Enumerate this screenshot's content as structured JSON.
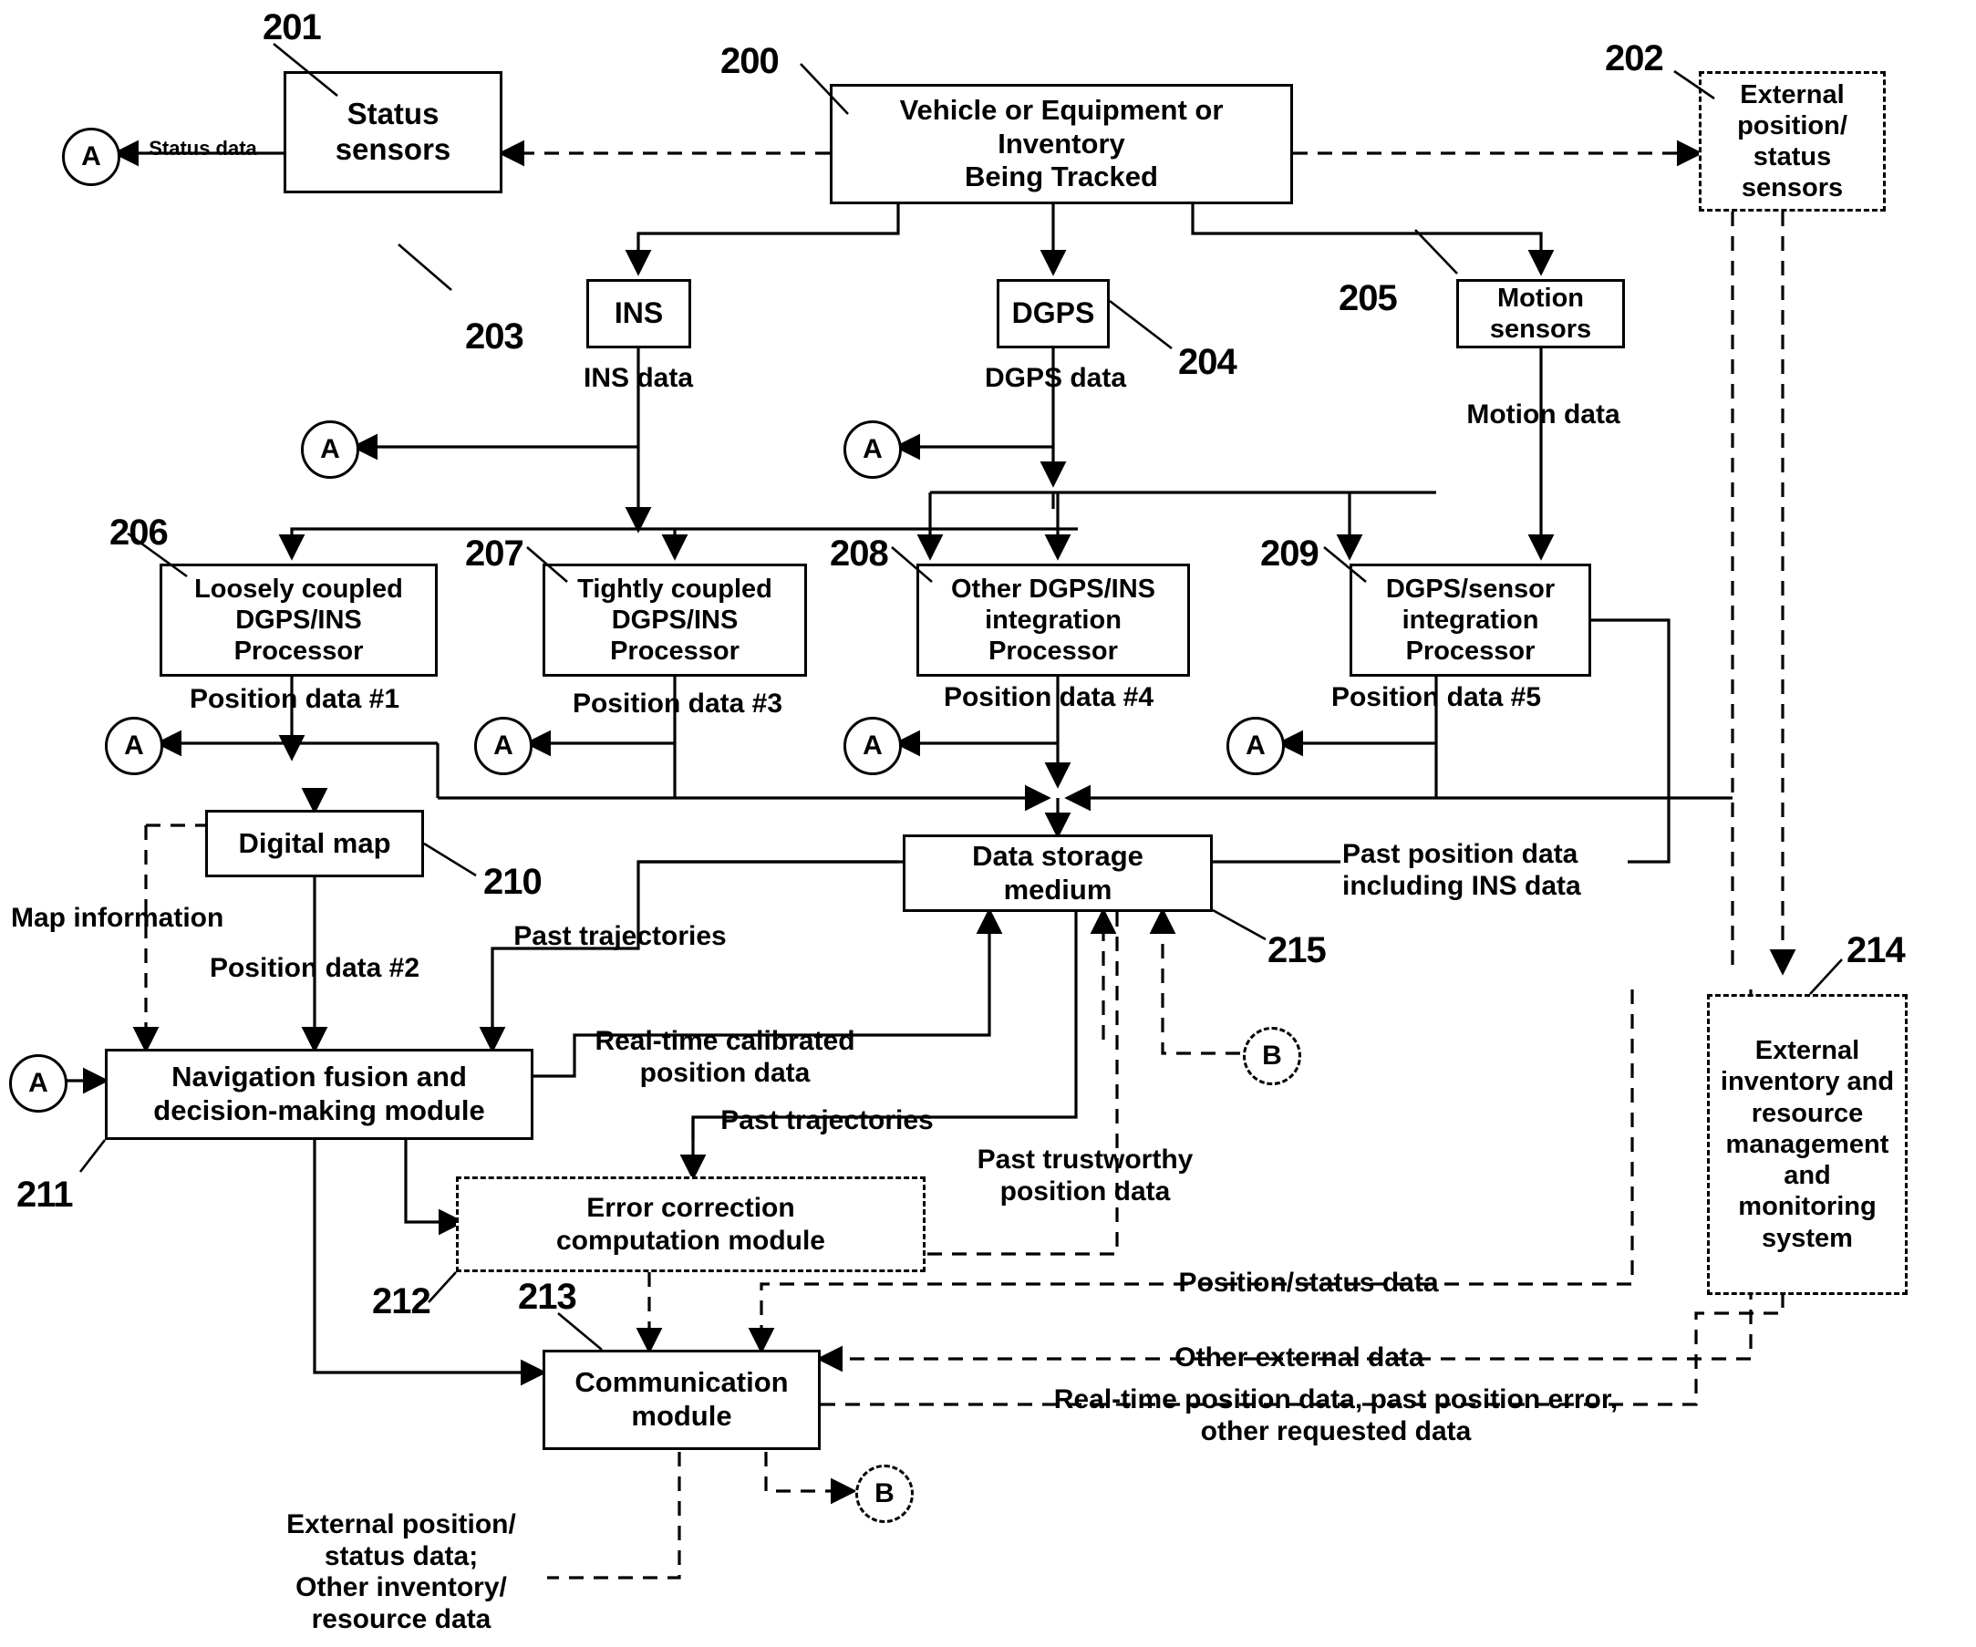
{
  "diagram": {
    "title": "Tracking system block diagram",
    "boxes": [
      {
        "id": "status_sensors",
        "ref": "201",
        "label": "Status\nsensors",
        "style": "solid"
      },
      {
        "id": "vehicle",
        "ref": "200",
        "label": "Vehicle or Equipment or\nInventory\nBeing Tracked",
        "style": "solid"
      },
      {
        "id": "external_sensors",
        "ref": "202",
        "label": "External\nposition/\nstatus\nsensors",
        "style": "dashed"
      },
      {
        "id": "ins",
        "ref": "203",
        "label": "INS",
        "style": "solid"
      },
      {
        "id": "dgps",
        "ref": "204",
        "label": "DGPS",
        "style": "solid"
      },
      {
        "id": "motion_sensors",
        "ref": "205",
        "label": "Motion\nsensors",
        "style": "solid"
      },
      {
        "id": "loosely_coupled",
        "ref": "206",
        "label": "Loosely coupled\nDGPS/INS\nProcessor",
        "style": "solid"
      },
      {
        "id": "tightly_coupled",
        "ref": "207",
        "label": "Tightly coupled\nDGPS/INS\nProcessor",
        "style": "solid"
      },
      {
        "id": "other_integration",
        "ref": "208",
        "label": "Other DGPS/INS\nintegration\nProcessor",
        "style": "solid"
      },
      {
        "id": "dgps_sensor_integration",
        "ref": "209",
        "label": "DGPS/sensor\nintegration\nProcessor",
        "style": "solid"
      },
      {
        "id": "digital_map",
        "ref": "210",
        "label": "Digital map",
        "style": "solid"
      },
      {
        "id": "navigation_fusion",
        "ref": "211",
        "label": "Navigation fusion and\ndecision-making module",
        "style": "solid"
      },
      {
        "id": "error_correction",
        "ref": "212",
        "label": "Error correction\ncomputation module",
        "style": "dashed"
      },
      {
        "id": "communication",
        "ref": "213",
        "label": "Communication\nmodule",
        "style": "solid"
      },
      {
        "id": "external_inventory",
        "ref": "214",
        "label": "External\ninventory and\nresource\nmanagement\nand\nmonitoring\nsystem",
        "style": "dashed"
      },
      {
        "id": "data_storage",
        "ref": "215",
        "label": "Data storage\nmedium",
        "style": "solid"
      }
    ],
    "reference_numerals": [
      "200",
      "201",
      "202",
      "203",
      "204",
      "205",
      "206",
      "207",
      "208",
      "209",
      "210",
      "211",
      "212",
      "213",
      "214",
      "215"
    ],
    "connectors": [
      {
        "id": "conn-a-status",
        "label": "A",
        "style": "solid"
      },
      {
        "id": "conn-a-ins",
        "label": "A",
        "style": "solid"
      },
      {
        "id": "conn-a-dgps",
        "label": "A",
        "style": "solid"
      },
      {
        "id": "conn-a-pos1",
        "label": "A",
        "style": "solid"
      },
      {
        "id": "conn-a-pos3",
        "label": "A",
        "style": "solid"
      },
      {
        "id": "conn-a-pos4",
        "label": "A",
        "style": "solid"
      },
      {
        "id": "conn-a-pos5",
        "label": "A",
        "style": "solid"
      },
      {
        "id": "conn-a-nav",
        "label": "A",
        "style": "solid"
      },
      {
        "id": "conn-b-storage",
        "label": "B",
        "style": "dashed"
      },
      {
        "id": "conn-b-comm",
        "label": "B",
        "style": "dashed"
      }
    ],
    "edge_labels": [
      {
        "id": "status_data",
        "text": "Status data"
      },
      {
        "id": "ins_data",
        "text": "INS data"
      },
      {
        "id": "dgps_data",
        "text": "DGPS data"
      },
      {
        "id": "motion_data",
        "text": "Motion data"
      },
      {
        "id": "position_data_1",
        "text": "Position data #1"
      },
      {
        "id": "position_data_3",
        "text": "Position data #3"
      },
      {
        "id": "position_data_4",
        "text": "Position data #4"
      },
      {
        "id": "position_data_5",
        "text": "Position data #5"
      },
      {
        "id": "position_data_2",
        "text": "Position data #2"
      },
      {
        "id": "map_information",
        "text": "Map information"
      },
      {
        "id": "past_trajectories_top",
        "text": "Past trajectories"
      },
      {
        "id": "past_position_data_ins",
        "text": "Past position data\nincluding INS data"
      },
      {
        "id": "realtime_calibrated",
        "text": "Real-time calibrated\nposition data"
      },
      {
        "id": "past_trajectories_mid",
        "text": "Past trajectories"
      },
      {
        "id": "past_trustworthy",
        "text": "Past trustworthy\nposition data"
      },
      {
        "id": "position_status_data",
        "text": "Position/status data"
      },
      {
        "id": "other_external_data",
        "text": "Other external data"
      },
      {
        "id": "realtime_position_data",
        "text": "Real-time position data, past position error,\nother requested data"
      },
      {
        "id": "external_position_status",
        "text": "External position/\nstatus data;\nOther inventory/\nresource data"
      }
    ]
  }
}
